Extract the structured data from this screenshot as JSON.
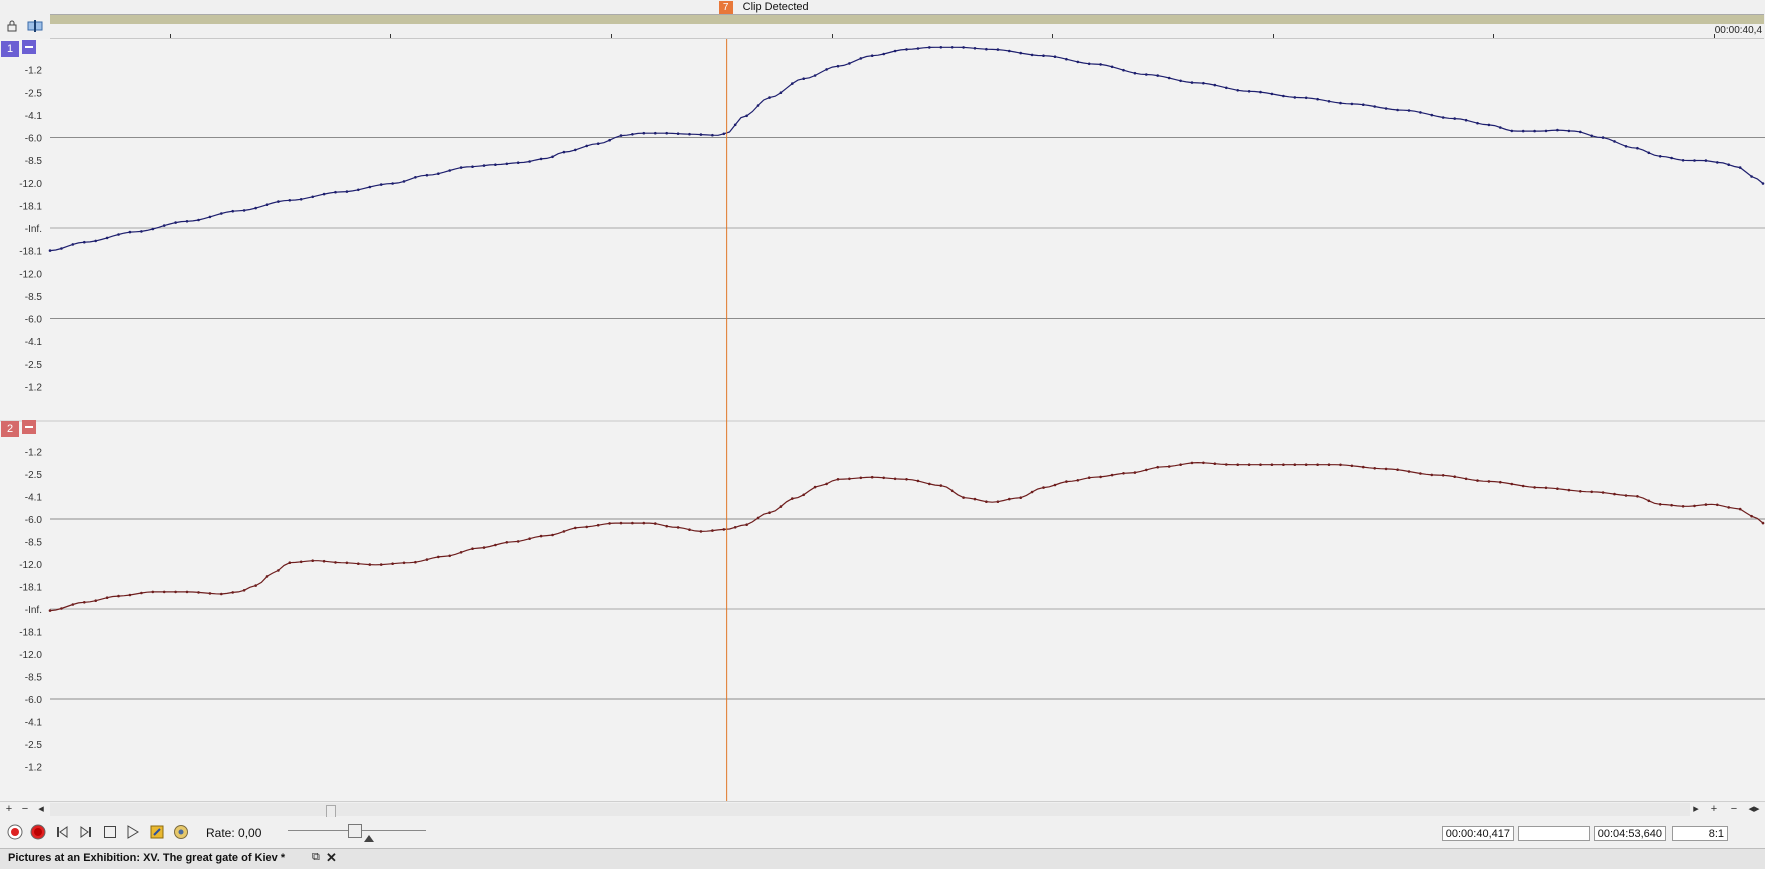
{
  "marker": {
    "number": "7",
    "label": "Clip Detected"
  },
  "ruler": {
    "end_time": "00:00:40,4"
  },
  "tracks": [
    {
      "number": "1",
      "color": "#6b5fd3",
      "line_color": "#1e1f6e",
      "axis_labels": [
        "-1.2",
        "-2.5",
        "-4.1",
        "-6.0",
        "-8.5",
        "-12.0",
        "-18.1",
        "-Inf.",
        "-18.1",
        "-12.0",
        "-8.5",
        "-6.0",
        "-4.1",
        "-2.5",
        "-1.2"
      ]
    },
    {
      "number": "2",
      "color": "#d56a6a",
      "line_color": "#6e1e1e",
      "axis_labels": [
        "-1.2",
        "-2.5",
        "-4.1",
        "-6.0",
        "-8.5",
        "-12.0",
        "-18.1",
        "-Inf.",
        "-18.1",
        "-12.0",
        "-8.5",
        "-6.0",
        "-4.1",
        "-2.5",
        "-1.2"
      ]
    }
  ],
  "colors": {
    "cursor": "#e07828",
    "reference_line": "#8c8c8c",
    "marker_flag": "#e8783a",
    "region_band": "#c4c2a0"
  },
  "icons": {
    "lock": "lock-icon",
    "snap": "snap-icon",
    "record_armed": "record-arm-icon",
    "record": "record-icon",
    "go_start": "go-to-start-icon",
    "go_end": "go-to-end-icon",
    "stop": "stop-icon",
    "play": "play-icon",
    "loop": "loop-icon",
    "settings": "settings-icon"
  },
  "transport": {
    "rate_label": "Rate: 0,00",
    "rate_value": 0.0,
    "cursor_time": "00:00:40,417",
    "selection_length": "",
    "total_length": "00:04:53,640",
    "zoom_ratio": "8:1"
  },
  "scrollbar": {
    "left_plus": "+",
    "left_minus": "−",
    "left_arrow": "◂",
    "right_arrow": "▸",
    "right_plus": "+",
    "right_minus": "−",
    "right_fit": "◂▸"
  },
  "document": {
    "title": "Pictures at an Exhibition: XV. The great gate of Kiev *",
    "restore_glyph": "⧉",
    "close_glyph": "✕"
  },
  "envelope_data": {
    "track1": [
      [
        0,
        0.0
      ],
      [
        0.02,
        0.04
      ],
      [
        0.05,
        0.09
      ],
      [
        0.08,
        0.14
      ],
      [
        0.11,
        0.19
      ],
      [
        0.14,
        0.24
      ],
      [
        0.17,
        0.28
      ],
      [
        0.2,
        0.32
      ],
      [
        0.22,
        0.36
      ],
      [
        0.245,
        0.4
      ],
      [
        0.26,
        0.41
      ],
      [
        0.275,
        0.42
      ],
      [
        0.29,
        0.44
      ],
      [
        0.3,
        0.47
      ],
      [
        0.32,
        0.51
      ],
      [
        0.335,
        0.55
      ],
      [
        0.345,
        0.56
      ],
      [
        0.36,
        0.56
      ],
      [
        0.375,
        0.555
      ],
      [
        0.39,
        0.55
      ],
      [
        0.395,
        0.56
      ],
      [
        0.405,
        0.64
      ],
      [
        0.42,
        0.73
      ],
      [
        0.44,
        0.82
      ],
      [
        0.46,
        0.88
      ],
      [
        0.48,
        0.93
      ],
      [
        0.5,
        0.96
      ],
      [
        0.515,
        0.97
      ],
      [
        0.53,
        0.97
      ],
      [
        0.55,
        0.96
      ],
      [
        0.58,
        0.93
      ],
      [
        0.61,
        0.89
      ],
      [
        0.64,
        0.84
      ],
      [
        0.67,
        0.8
      ],
      [
        0.7,
        0.76
      ],
      [
        0.73,
        0.73
      ],
      [
        0.76,
        0.7
      ],
      [
        0.79,
        0.67
      ],
      [
        0.82,
        0.63
      ],
      [
        0.84,
        0.6
      ],
      [
        0.855,
        0.57
      ],
      [
        0.87,
        0.57
      ],
      [
        0.88,
        0.575
      ],
      [
        0.89,
        0.57
      ],
      [
        0.905,
        0.54
      ],
      [
        0.925,
        0.49
      ],
      [
        0.94,
        0.45
      ],
      [
        0.955,
        0.43
      ],
      [
        0.965,
        0.43
      ],
      [
        0.975,
        0.42
      ],
      [
        0.985,
        0.4
      ],
      [
        0.995,
        0.35
      ],
      [
        1.0,
        0.32
      ]
    ],
    "track2": [
      [
        0,
        0.1
      ],
      [
        0.02,
        0.14
      ],
      [
        0.04,
        0.17
      ],
      [
        0.06,
        0.19
      ],
      [
        0.08,
        0.19
      ],
      [
        0.1,
        0.18
      ],
      [
        0.11,
        0.19
      ],
      [
        0.12,
        0.22
      ],
      [
        0.13,
        0.28
      ],
      [
        0.14,
        0.33
      ],
      [
        0.155,
        0.34
      ],
      [
        0.17,
        0.33
      ],
      [
        0.19,
        0.32
      ],
      [
        0.21,
        0.33
      ],
      [
        0.23,
        0.36
      ],
      [
        0.25,
        0.4
      ],
      [
        0.27,
        0.43
      ],
      [
        0.29,
        0.46
      ],
      [
        0.31,
        0.5
      ],
      [
        0.33,
        0.52
      ],
      [
        0.35,
        0.52
      ],
      [
        0.365,
        0.5
      ],
      [
        0.38,
        0.48
      ],
      [
        0.395,
        0.49
      ],
      [
        0.405,
        0.51
      ],
      [
        0.42,
        0.57
      ],
      [
        0.435,
        0.64
      ],
      [
        0.45,
        0.7
      ],
      [
        0.46,
        0.73
      ],
      [
        0.48,
        0.74
      ],
      [
        0.5,
        0.73
      ],
      [
        0.52,
        0.7
      ],
      [
        0.535,
        0.64
      ],
      [
        0.55,
        0.62
      ],
      [
        0.565,
        0.64
      ],
      [
        0.58,
        0.69
      ],
      [
        0.595,
        0.72
      ],
      [
        0.61,
        0.74
      ],
      [
        0.63,
        0.76
      ],
      [
        0.65,
        0.79
      ],
      [
        0.67,
        0.81
      ],
      [
        0.69,
        0.8
      ],
      [
        0.72,
        0.8
      ],
      [
        0.75,
        0.8
      ],
      [
        0.78,
        0.78
      ],
      [
        0.81,
        0.75
      ],
      [
        0.84,
        0.72
      ],
      [
        0.87,
        0.69
      ],
      [
        0.9,
        0.67
      ],
      [
        0.925,
        0.65
      ],
      [
        0.94,
        0.61
      ],
      [
        0.955,
        0.6
      ],
      [
        0.97,
        0.61
      ],
      [
        0.985,
        0.59
      ],
      [
        0.995,
        0.55
      ],
      [
        1.0,
        0.52
      ]
    ],
    "cursor_fraction": 0.395
  }
}
